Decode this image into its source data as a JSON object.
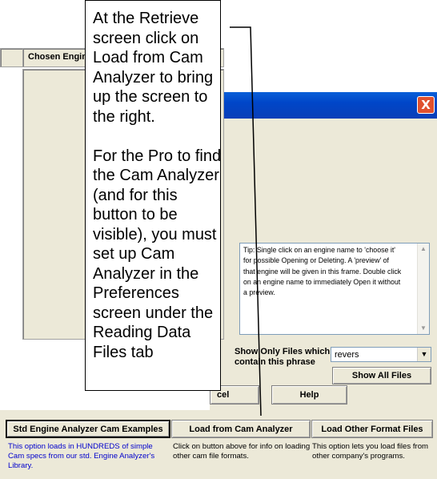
{
  "dialog": {
    "close_glyph": "X",
    "chosen_engine_label": "Chosen Engine File:",
    "tip": "Tip: Single click on an engine name to 'choose it' for possible Opening or Deleting. A 'preview' of that engine will be given in this frame.   Double click on an engine name to immediately Open it without a preview.",
    "filter_label": "Show Only Files which contain this phrase",
    "filter_value": "revers",
    "show_all_label": "Show All Files",
    "cancel_label": "cel",
    "help_label": "Help"
  },
  "load_options": {
    "std_label": "Std Engine Analyzer Cam Examples",
    "std_desc": "This option loads in HUNDREDS of simple Cam specs from our std. Engine Analyzer's Library.",
    "cam_label": "Load from Cam Analyzer",
    "cam_desc": "Click on button above for info on loading other cam file formats.",
    "other_label": "Load Other Format Files",
    "other_desc": "This option lets you load files from other company's programs."
  },
  "callout": {
    "text": "At the Retrieve screen click on Load from Cam Analyzer to bring up the screen to the right.\n\nFor the Pro to find the Cam Analyzer (and for this button to be visible), you must set up Cam Analyzer in the Preferences screen under the Reading Data Files tab"
  },
  "colors": {
    "titlebar": "#0046c8",
    "window_face": "#ece9d8",
    "close_button": "#e0512f",
    "std_desc_text": "#0000cc"
  },
  "icons": [
    "close-icon",
    "scroll-up-icon",
    "scroll-down-icon",
    "dropdown-arrow-icon"
  ]
}
